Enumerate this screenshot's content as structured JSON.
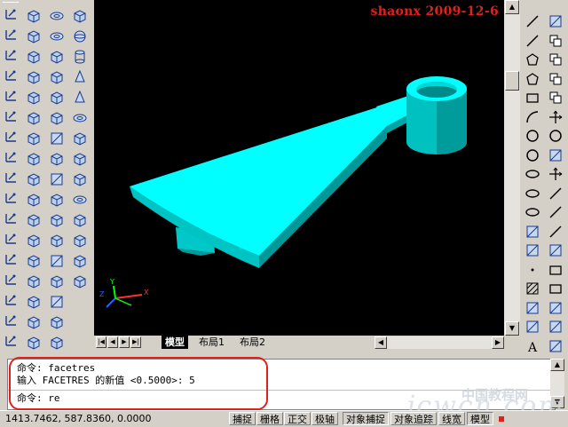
{
  "watermark": {
    "text": "shaonx 2009-12-6",
    "color": "#e0201c"
  },
  "layout_tabs": [
    {
      "label": "模型",
      "active": true
    },
    {
      "label": "布局1",
      "active": false
    },
    {
      "label": "布局2",
      "active": false
    }
  ],
  "command_window": {
    "lines": [
      "命令: facetres",
      "输入 FACETRES 的新值 <0.5000>: 5"
    ],
    "prompt": "命令: re"
  },
  "status_bar": {
    "coordinates": "1413.7462, 587.8360, 0.0000",
    "toggles": [
      {
        "label": "捕捉",
        "on": false
      },
      {
        "label": "栅格",
        "on": false
      },
      {
        "label": "正交",
        "on": false
      },
      {
        "label": "极轴",
        "on": false
      },
      {
        "label": "对象捕捉",
        "on": true
      },
      {
        "label": "对象追踪",
        "on": false
      },
      {
        "label": "线宽",
        "on": false
      },
      {
        "label": "模型",
        "on": true
      }
    ]
  },
  "watermark_site": {
    "text": "中国教程网",
    "url_text": "jcwcn.com"
  },
  "colors": {
    "model_fill": "#00ffff",
    "model_shade": "#00b8b8",
    "viewport_bg": "#000000"
  },
  "icons": {
    "left_col1": [
      "line-icon",
      "rect-icon",
      "angle-icon",
      "dim-icon",
      "dim2-icon",
      "dim3-icon",
      "dim4-icon",
      "dim5-icon",
      "dim6-icon",
      "dim7-icon",
      "dim8-icon",
      "dim9-icon",
      "dim10-icon",
      "dim11-icon",
      "dim12-icon",
      "dim13-icon"
    ],
    "right_draw": [
      "line-icon",
      "construction-line-icon",
      "polyline-icon",
      "polygon-icon",
      "rectangle-icon",
      "arc-icon",
      "circle-icon",
      "revcloud-icon",
      "spline-icon",
      "ellipse-icon",
      "ellipse-arc-icon",
      "insert-block-icon",
      "make-block-icon",
      "point-icon",
      "hatch-icon",
      "region-icon",
      "table-icon",
      "text-icon"
    ]
  }
}
